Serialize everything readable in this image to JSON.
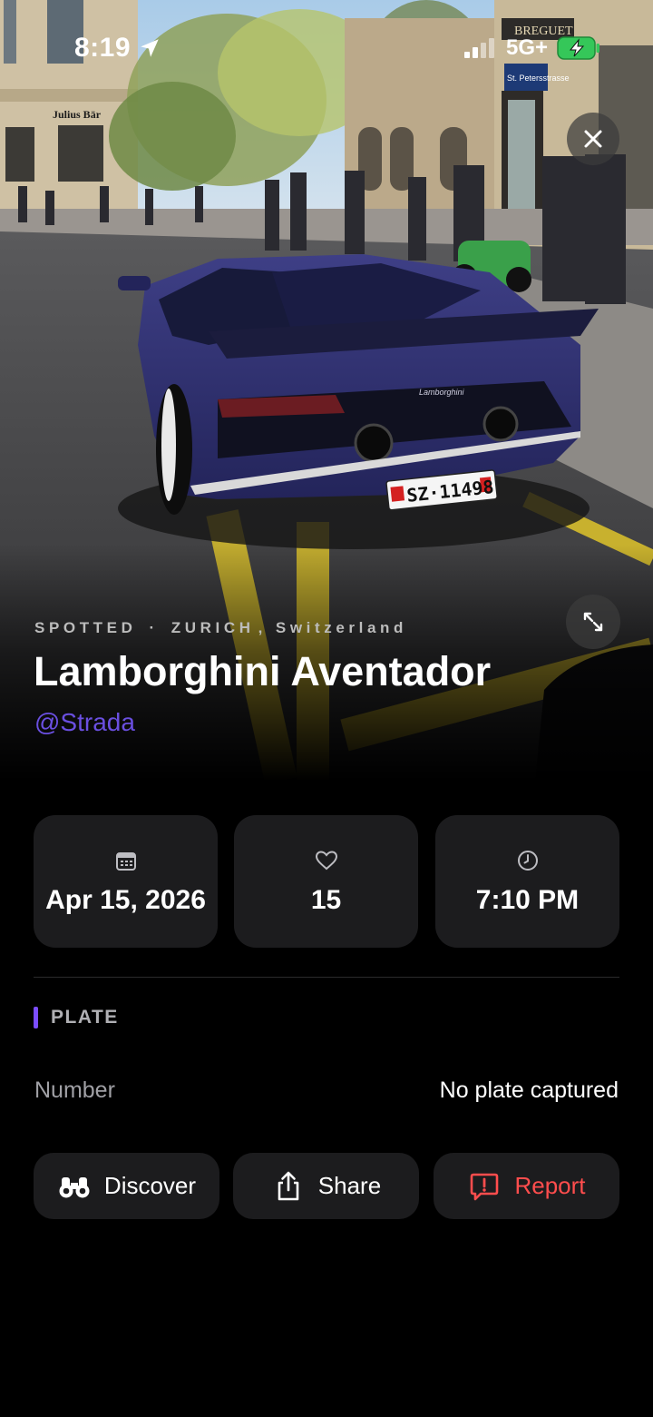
{
  "status_bar": {
    "time": "8:19",
    "network": "5G+"
  },
  "hero": {
    "sign_shop": "Julius Bär",
    "sign_breguet": "BREGUET",
    "sign_street": "St. Petersstrasse",
    "plate_text": "SZ·11498",
    "car_badge": "Lamborghini"
  },
  "spot": {
    "kicker_label": "SPOTTED",
    "kicker_sep": "·",
    "city": "ZURICH",
    "country_sep": ",",
    "country": "Switzerland",
    "title": "Lamborghini Aventador",
    "user": "@Strada"
  },
  "stats": {
    "date": "Apr 15, 2026",
    "likes": "15",
    "time": "7:10 PM"
  },
  "plate": {
    "section_title": "PLATE",
    "label": "Number",
    "value": "No plate captured"
  },
  "actions": {
    "discover": "Discover",
    "share": "Share",
    "report": "Report"
  },
  "colors": {
    "accent": "#7b4dff",
    "user_link": "#6a4fe0",
    "report": "#ff4d4d",
    "card_bg": "#1c1c1e"
  },
  "icons": [
    "location-arrow-icon",
    "signal-icon",
    "battery-charging-icon",
    "close-icon",
    "expand-icon",
    "calendar-icon",
    "heart-icon",
    "clock-icon",
    "binoculars-icon",
    "share-icon",
    "report-icon"
  ]
}
